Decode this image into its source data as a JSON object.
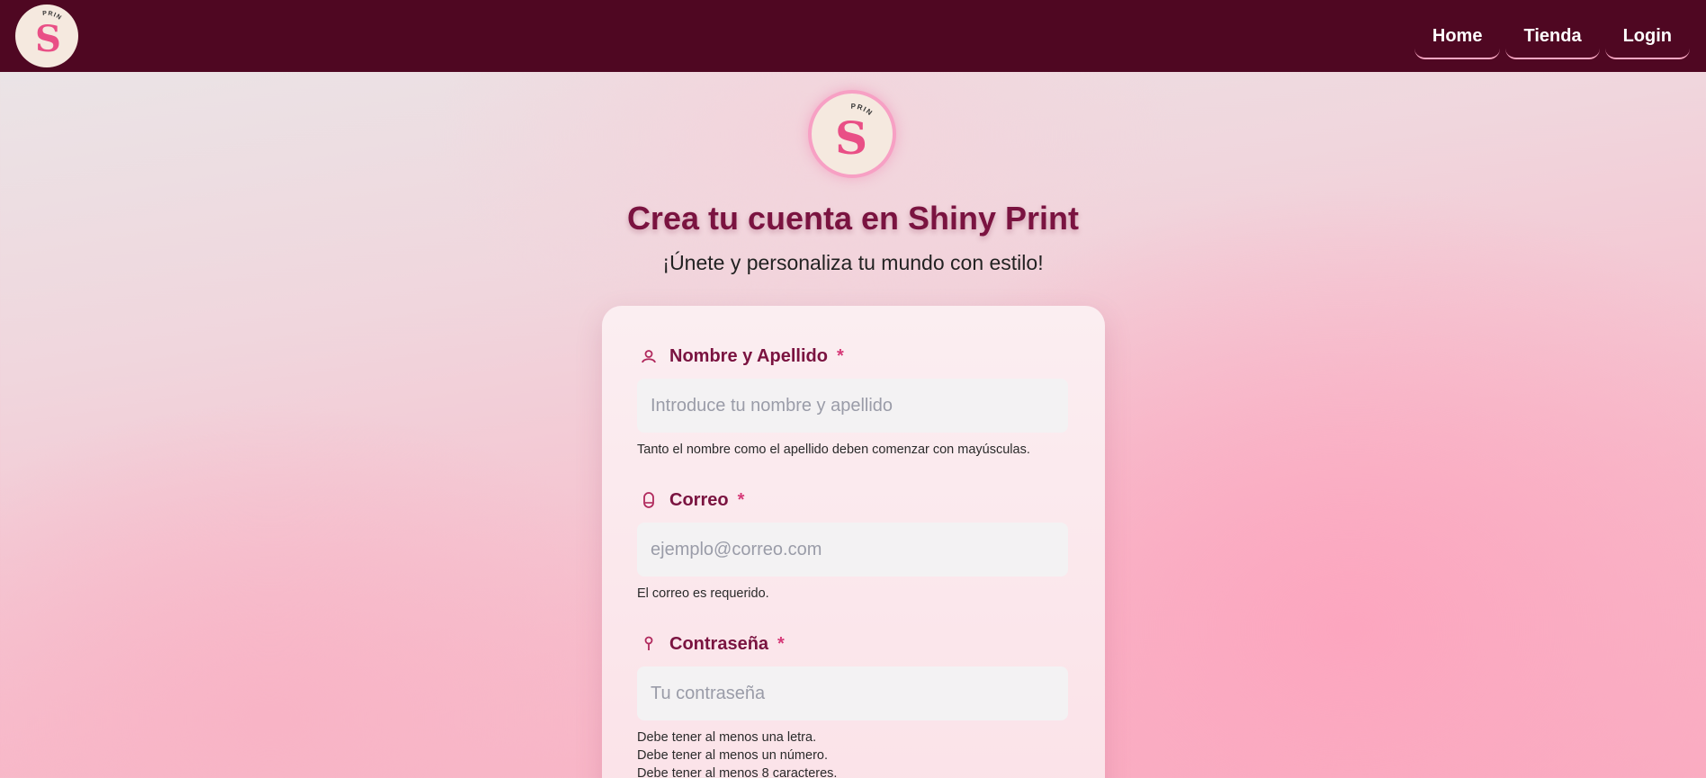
{
  "nav": {
    "logo": {
      "letter": "S",
      "arc_text": "PRINT"
    },
    "links": [
      {
        "label": "Home"
      },
      {
        "label": "Tienda"
      },
      {
        "label": "Login"
      }
    ]
  },
  "hero": {
    "logo": {
      "letter": "S",
      "arc_text": "PRINT"
    },
    "title": "Crea tu cuenta en Shiny Print",
    "subtitle": "¡Únete y personaliza tu mundo con estilo!"
  },
  "form": {
    "name": {
      "label": "Nombre y Apellido",
      "required_mark": "*",
      "icon": "user-icon",
      "placeholder": "Introduce tu nombre y apellido",
      "value": "",
      "hint": "Tanto el nombre como el apellido deben comenzar con mayúsculas."
    },
    "email": {
      "label": "Correo",
      "required_mark": "*",
      "icon": "mail-icon",
      "placeholder": "ejemplo@correo.com",
      "value": "",
      "hint": "El correo es requerido."
    },
    "password": {
      "label": "Contraseña",
      "required_mark": "*",
      "icon": "key-icon",
      "placeholder": "Tu contraseña",
      "value": "",
      "hints": [
        "Debe tener al menos una letra.",
        "Debe tener al menos un número.",
        "Debe tener al menos 8 caracteres."
      ]
    }
  },
  "colors": {
    "navbar": "#4f0722",
    "title": "#7a1340",
    "accent": "#d63a78",
    "logo_letter": "#e94f86",
    "logo_bg": "#f5e9df"
  }
}
